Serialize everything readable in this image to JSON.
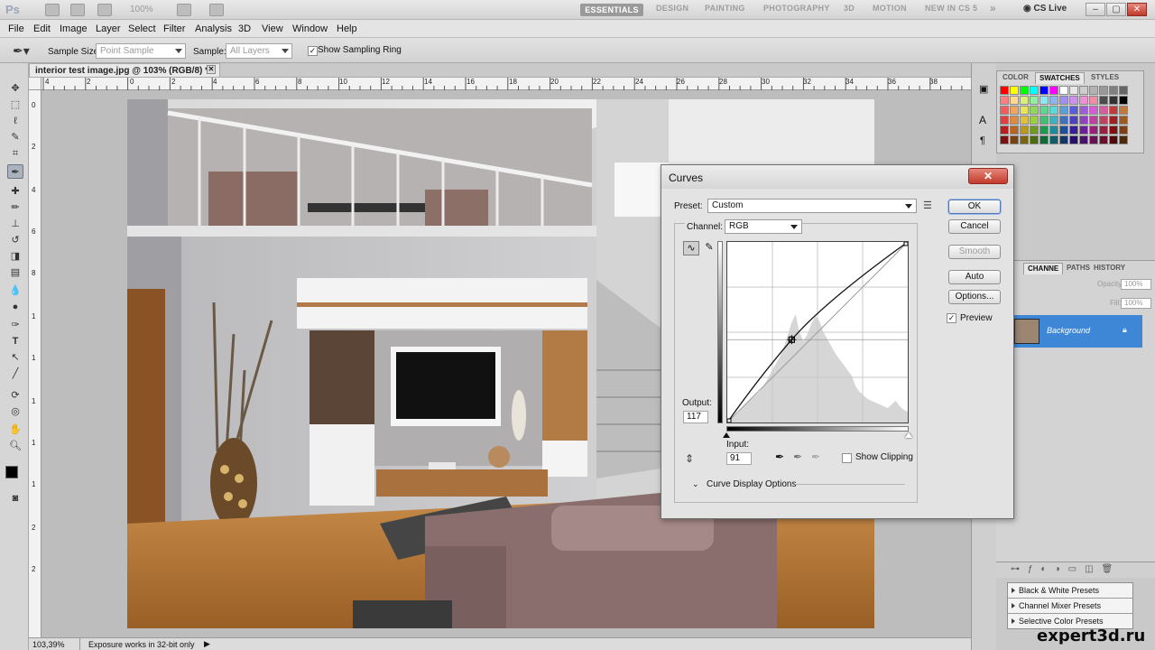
{
  "app": {
    "logo": "Ps",
    "zoom": "100%",
    "workspaces": [
      "ESSENTIALS",
      "DESIGN",
      "PAINTING",
      "PHOTOGRAPHY",
      "3D",
      "MOTION",
      "NEW IN CS 5"
    ],
    "more": "»",
    "cslive": "CS Live"
  },
  "menu": [
    "File",
    "Edit",
    "Image",
    "Layer",
    "Select",
    "Filter",
    "Analysis",
    "3D",
    "View",
    "Window",
    "Help"
  ],
  "options": {
    "sample_size_label": "Sample Size:",
    "sample_size_value": "Point Sample",
    "sample_label": "Sample:",
    "sample_value": "All Layers",
    "show_ring_label": "Show Sampling Ring",
    "show_ring_checked": true
  },
  "document": {
    "tab_title": "interior test image.jpg @ 103% (RGB/8) *",
    "ruler_top": [
      "4",
      "2",
      "0",
      "2",
      "4",
      "6",
      "8",
      "10",
      "12",
      "14",
      "16",
      "18",
      "20",
      "22",
      "24",
      "26",
      "28",
      "30",
      "32",
      "34",
      "36",
      "38"
    ],
    "ruler_left": [
      "0",
      "2",
      "4",
      "6",
      "8",
      "1",
      "1",
      "1",
      "1",
      "1",
      "2",
      "2"
    ]
  },
  "status": {
    "zoom": "103,39%",
    "message": "Exposure works in 32-bit only"
  },
  "color_panel": {
    "tabs": [
      "COLOR",
      "SWATCHES",
      "STYLES"
    ],
    "active_tab": "SWATCHES"
  },
  "layers_panel": {
    "tabs": [
      "CHANNE",
      "PATHS",
      "HISTORY"
    ],
    "opacity_label": "Opacity:",
    "opacity_value": "100%",
    "fill_label": "Fill:",
    "fill_value": "100%",
    "layer_name": "Background"
  },
  "adjustment_presets": [
    "Black & White Presets",
    "Channel Mixer Presets",
    "Selective Color Presets"
  ],
  "watermark": "expert3d.ru",
  "curves": {
    "title": "Curves",
    "preset_label": "Preset:",
    "preset_value": "Custom",
    "channel_label": "Channel:",
    "channel_value": "RGB",
    "output_label": "Output:",
    "output_value": "117",
    "input_label": "Input:",
    "input_value": "91",
    "show_clipping_label": "Show Clipping",
    "show_clipping_checked": false,
    "display_options_label": "Curve Display Options",
    "buttons": {
      "ok": "OK",
      "cancel": "Cancel",
      "smooth": "Smooth",
      "auto": "Auto",
      "options": "Options..."
    },
    "preview_label": "Preview",
    "preview_checked": true,
    "close": "✕",
    "control_point": {
      "input": 91,
      "output": 117
    }
  }
}
